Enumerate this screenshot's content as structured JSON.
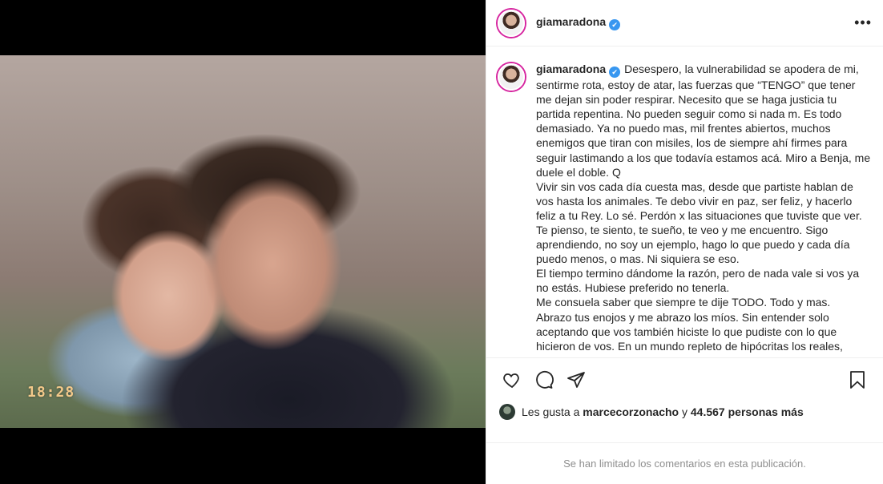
{
  "post": {
    "username": "giamaradona",
    "verified_mark": "✔",
    "more_label": "•••",
    "photo_timestamp": "18:28",
    "caption": "Desespero, la vulnerabilidad se apodera de mi, sentirme rota, estoy de atar, las fuerzas que “TENGO” que tener me dejan sin poder respirar. Necesito que se haga justicia tu partida repentina. No pueden seguir como si nada m. Es todo demasiado. Ya no puedo mas, mil frentes abiertos, muchos enemigos que tiran con misiles, los de siempre ahí firmes para seguir lastimando a los que todavía estamos acá. Miro a Benja, me duele el doble. Q\nVivir sin vos cada día cuesta mas, desde que partiste hablan de vos hasta los animales. Te debo vivir en paz, ser feliz, y hacerlo feliz a tu Rey. Lo sé. Perdón x las situaciones que tuviste que ver.\nTe pienso, te siento, te sueño, te veo y me encuentro. Sigo aprendiendo, no soy un ejemplo, hago lo que puedo y cada día puedo menos, o mas. Ni siquiera se eso.\nEl tiempo termino dándome la razón, pero de nada vale si vos ya no estás. Hubiese preferido no tenerla.\nMe consuela saber que siempre te dije TODO. Todo y mas.\nAbrazo tus enojos y me abrazo los míos. Sin entender solo aceptando que vos también hiciste lo que pudiste con lo que hicieron de vos. En un mundo repleto de hipócritas los reales, diferentes, los que viven sin pedir explicaciones, los que hacen lo"
  },
  "likes": {
    "prefix": "Les gusta a",
    "liker": "marcecorzonacho",
    "connector": "y",
    "others": "44.567 personas más"
  },
  "comments_notice": "Se han limitado los comentarios en esta publicación.",
  "icons": [
    "heart-icon",
    "comment-icon",
    "share-icon",
    "bookmark-icon",
    "more-icon",
    "verified-icon"
  ],
  "colors": {
    "text": "#262626",
    "muted": "#8e8e8e",
    "verified": "#3897f0",
    "border": "#efefef"
  }
}
